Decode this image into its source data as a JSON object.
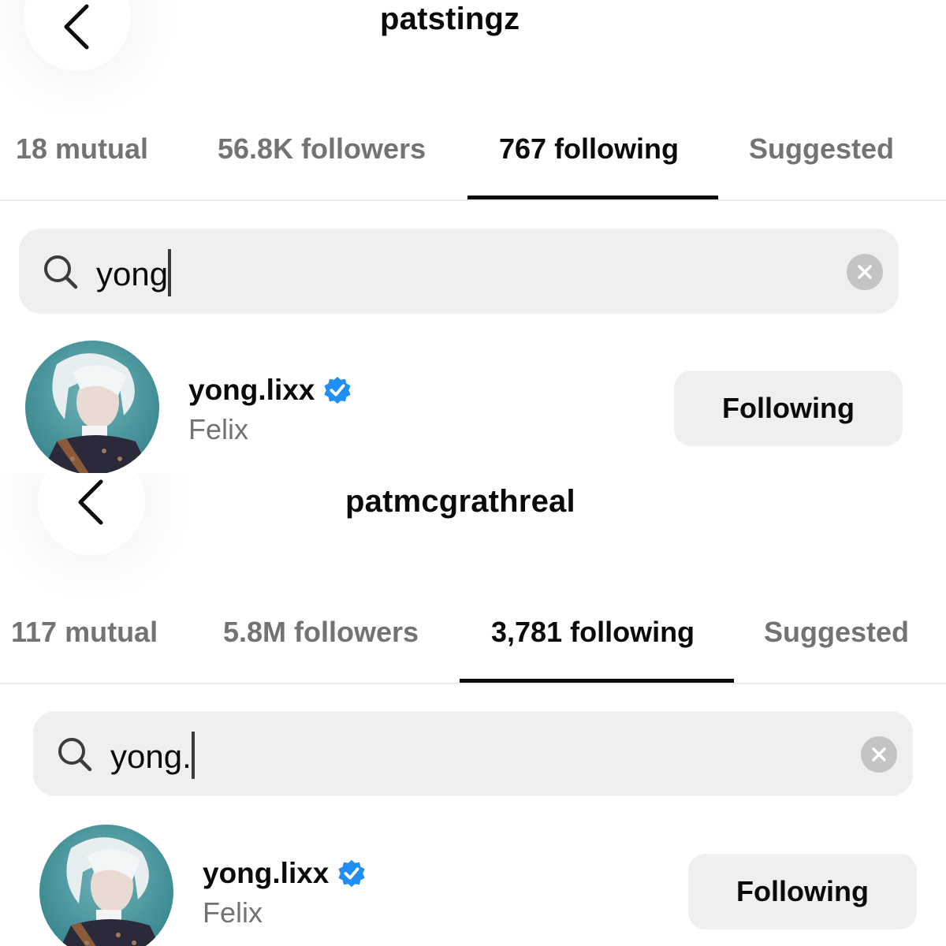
{
  "panels": [
    {
      "profile_username": "patstingz",
      "tabs": [
        {
          "label": "18 mutual",
          "active": false
        },
        {
          "label": "56.8K followers",
          "active": false
        },
        {
          "label": "767 following",
          "active": true
        },
        {
          "label": "Suggested",
          "active": false
        }
      ],
      "search": {
        "value": "yong",
        "icon": "search-icon",
        "clear_icon": "clear-icon"
      },
      "result": {
        "handle": "yong.lixx",
        "verified": true,
        "name": "Felix",
        "button_label": "Following"
      }
    },
    {
      "profile_username": "patmcgrathreal",
      "tabs": [
        {
          "label": "117 mutual",
          "active": false
        },
        {
          "label": "5.8M followers",
          "active": false
        },
        {
          "label": "3,781 following",
          "active": true
        },
        {
          "label": "Suggested",
          "active": false
        }
      ],
      "search": {
        "value": "yong.",
        "icon": "search-icon",
        "clear_icon": "clear-icon"
      },
      "result": {
        "handle": "yong.lixx",
        "verified": true,
        "name": "Felix",
        "button_label": "Following"
      }
    }
  ],
  "colors": {
    "text_primary": "#0a0a0a",
    "text_secondary": "#737373",
    "search_bg": "#efeff1",
    "button_bg": "#efeff1",
    "verified_blue": "#1f8ff5",
    "clear_bg": "#c4c4c6"
  }
}
